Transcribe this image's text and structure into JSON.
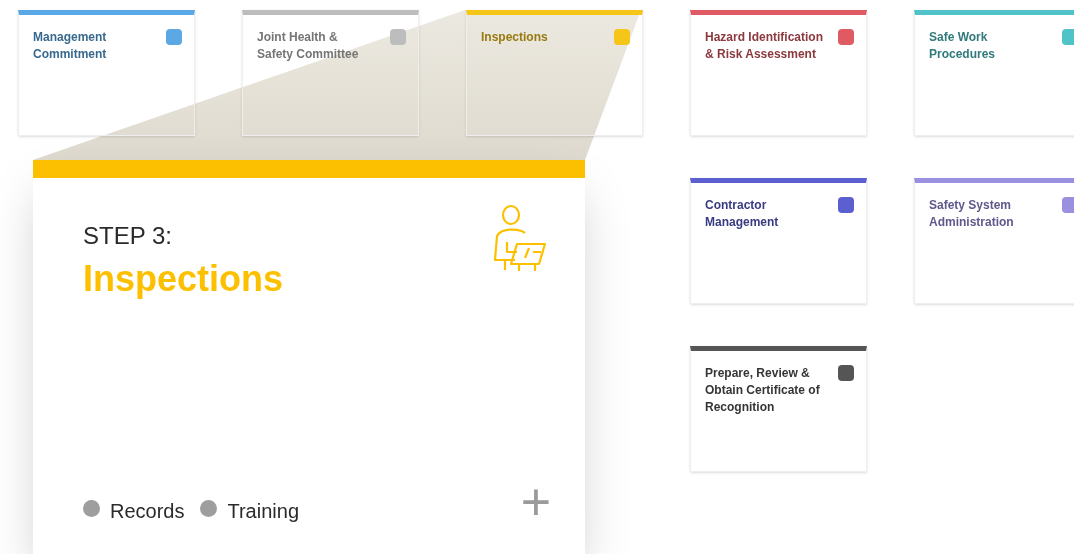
{
  "background_steps": {
    "row_1": [
      {
        "title": "Management Commitment",
        "color": "#5aa9e6"
      },
      {
        "title": "Joint Health & Safety Committee",
        "color": "#bdbdbd"
      },
      {
        "title": "Inspections",
        "color": "#f5c518"
      },
      {
        "title": "Hazard Identification & Risk Assessment",
        "color": "#e05a64"
      },
      {
        "title": "Safe Work Procedures",
        "color": "#4fc3c8"
      }
    ],
    "row_2": [
      {
        "title": "Contractor Management",
        "color": "#5b5fd0"
      },
      {
        "title": "Safety System Administration",
        "color": "#9a90e0"
      }
    ],
    "row_3": [
      {
        "title": "Prepare, Review & Obtain Certificate of Recognition",
        "color": "#555555"
      }
    ]
  },
  "zoomed_card": {
    "step_label": "STEP 3:",
    "title": "Inspections",
    "color": "#fcc000",
    "tags": [
      "Records",
      "Training"
    ],
    "add_symbol": "+"
  }
}
